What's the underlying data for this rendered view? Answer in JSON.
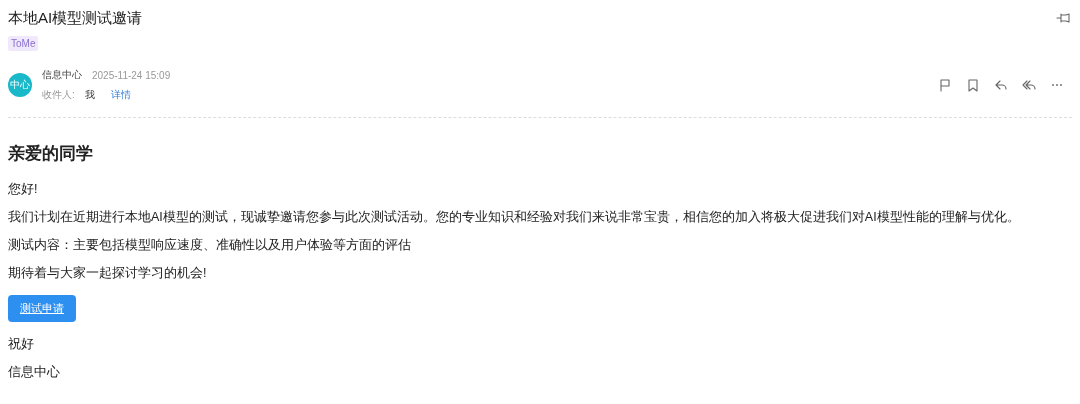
{
  "mail": {
    "subject": "本地AI模型测试邀请",
    "tags": [
      "ToMe"
    ],
    "sender": {
      "avatar_text": "中心",
      "name": "信息中心",
      "time": "2025-11-24 15:09"
    },
    "recipients": {
      "label": "收件人:",
      "value": "我",
      "details_link": "详情"
    }
  },
  "body": {
    "heading": "亲爱的同学",
    "paragraphs": [
      "您好!",
      "我们计划在近期进行本地AI模型的测试，现诚挚邀请您参与此次测试活动。您的专业知识和经验对我们来说非常宝贵，相信您的加入将极大促进我们对AI模型性能的理解与优化。",
      "测试内容：主要包括模型响应速度、准确性以及用户体验等方面的评估",
      "期待着与大家一起探讨学习的机会!"
    ],
    "button": "测试申请",
    "closing": [
      "祝好",
      "信息中心"
    ]
  }
}
